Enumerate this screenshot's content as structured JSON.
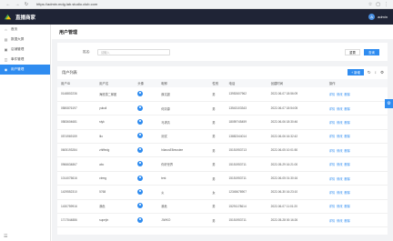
{
  "browser": {
    "url": "https://admin.mdg.lab.studio.club.com"
  },
  "header": {
    "app_title": "直播商家",
    "user_name": "admin",
    "user_initial": "A"
  },
  "sidebar": {
    "items": [
      {
        "label": "首页",
        "icon": "home-icon",
        "glyph": "⌂"
      },
      {
        "label": "数据大屏",
        "icon": "chart-icon",
        "glyph": "▤"
      },
      {
        "label": "店铺管理",
        "icon": "shop-icon",
        "glyph": "▣"
      },
      {
        "label": "事件管理",
        "icon": "event-icon",
        "glyph": "◫"
      },
      {
        "label": "用户管理",
        "icon": "user-icon",
        "glyph": "◉"
      }
    ],
    "collapse_glyph": "☰"
  },
  "page": {
    "title": "用户管理"
  },
  "filter": {
    "label": "姓名:",
    "placeholder": "请输入",
    "reset_label": "重置",
    "query_label": "查询"
  },
  "list": {
    "title": "用户列表",
    "add_label": "新增",
    "columns": [
      "用户ID",
      "用户名",
      "头像",
      "昵称",
      "性别",
      "电话",
      "创建时间",
      "操作"
    ],
    "actions": [
      "详情",
      "修改",
      "删除"
    ],
    "rows": [
      {
        "id": "0148802236",
        "username": "海底捞二郎团",
        "nickname": "薛文超",
        "gender": "男",
        "phone": "13952607962",
        "created": "2022-06-07 18:56:09"
      },
      {
        "id": "0580876197",
        "username": "yukuli",
        "nickname": "何清源",
        "gender": "男",
        "phone": "13543103343",
        "created": "2022-06-07 18:54:05"
      },
      {
        "id": "0583604681",
        "username": "styk",
        "nickname": "马求清",
        "gender": "男",
        "phone": "18059745459",
        "created": "2022-06-06 18:30:46"
      },
      {
        "id": "0574969159",
        "username": "lilo",
        "nickname": "测试",
        "gender": "男",
        "phone": "13882344014",
        "created": "2022-06-06 16:32:42"
      },
      {
        "id": "0605193284",
        "username": "zhiffedg",
        "nickname": "hilarusE8reustee",
        "gender": "男",
        "phone": "15151953713",
        "created": "2022-06-05 10:01:50"
      },
      {
        "id": "0966634867",
        "username": "abc",
        "nickname": "你好世界",
        "gender": "男",
        "phone": "15151953711",
        "created": "2022-05-29 16:21:00"
      },
      {
        "id": "1014075616",
        "username": "ctrmg",
        "nickname": "test",
        "gender": "男",
        "phone": "15151953711",
        "created": "2022-06-05 01:30:16"
      },
      {
        "id": "1429552310",
        "username": "5768",
        "nickname": "炎",
        "gender": "女",
        "phone": "12345678907",
        "created": "2022-06-30 16:23:10"
      },
      {
        "id": "1430759916",
        "username": "我危",
        "nickname": "我危",
        "gender": "男",
        "phone": "15291178614",
        "created": "2022-06-07 11:01:20"
      },
      {
        "id": "1717544886",
        "username": "supejin",
        "nickname": "JIWKO",
        "gender": "男",
        "phone": "15151953711",
        "created": "2022-05-28 00:16:26"
      }
    ]
  },
  "colors": {
    "accent": "#2f8cf0",
    "header_bg": "#1f2436"
  }
}
